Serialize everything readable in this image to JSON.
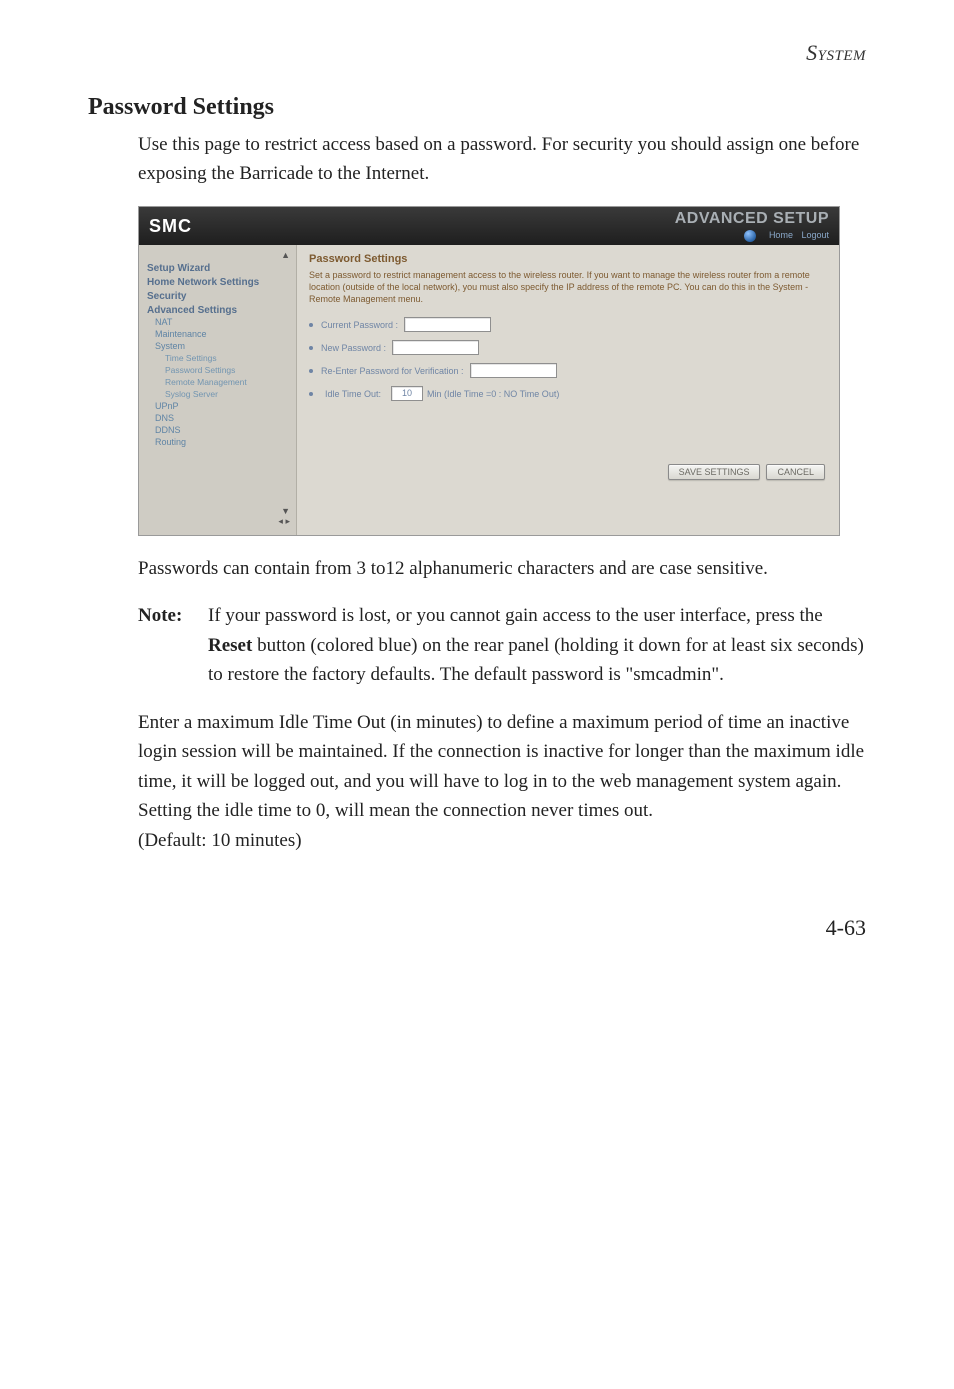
{
  "page": {
    "header": "System",
    "section_title": "Password Settings",
    "intro": "Use this page to restrict access based on a password. For security you should assign one before exposing the Barricade to the Internet.",
    "after_shot": "Passwords can contain from 3 to12 alphanumeric characters and are case sensitive.",
    "note_label": "Note:",
    "note_text_1": "If your password is lost, or you cannot gain access to the user interface, press the ",
    "note_bold": "Reset",
    "note_text_2": " button (colored blue) on the rear panel (holding it down for at least six seconds) to restore the factory defaults. The default password is \"smcadmin\".",
    "idle_para": "Enter a maximum Idle Time Out (in minutes) to define a maximum period of time an inactive login session will be maintained. If the connection is inactive for longer than the maximum idle time, it will be logged out, and you will have to log in to the web management system again. Setting the idle time to 0, will mean the connection never times out.",
    "default_line": "(Default: 10 minutes)",
    "page_number": "4-63"
  },
  "router": {
    "logo": "SMC",
    "top_right_title": "ADVANCED SETUP",
    "top_home": "Home",
    "top_logout": "Logout",
    "sidebar": {
      "main": [
        "Setup Wizard",
        "Home Network Settings",
        "Security",
        "Advanced Settings"
      ],
      "sub": [
        "NAT",
        "Maintenance",
        "System"
      ],
      "sub2": [
        "Time Settings",
        "Password Settings",
        "Remote Management",
        "Syslog Server"
      ],
      "sub3": [
        "UPnP",
        "DNS",
        "DDNS",
        "Routing"
      ]
    },
    "content": {
      "title": "Password Settings",
      "desc": "Set a password to restrict management access to the wireless router. If you want to manage the wireless router from a remote location (outside of the local network), you must also specify the IP address of the remote PC. You can do this in the System - Remote Management menu.",
      "current_pw": "Current Password :",
      "new_pw": "New Password :",
      "reenter_pw": "Re-Enter Password for Verification :",
      "idle_pre": "Idle Time Out:",
      "idle_value": "10",
      "idle_post": "Min (Idle Time =0 : NO Time Out)",
      "save_btn": "SAVE SETTINGS",
      "cancel_btn": "CANCEL"
    }
  }
}
